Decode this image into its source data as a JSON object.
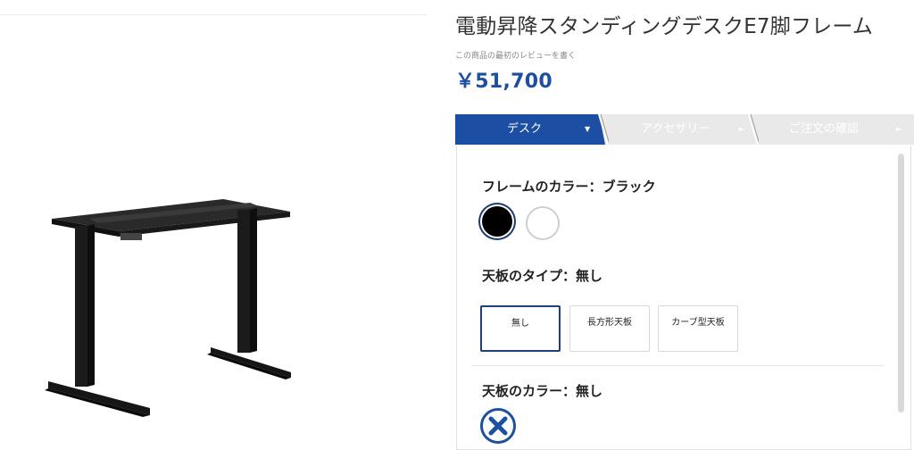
{
  "product": {
    "title": "電動昇降スタンディングデスクE7脚フレーム",
    "review_link": "この商品の最初のレビューを書く",
    "price": "￥51,700"
  },
  "steps": [
    {
      "label": "デスク",
      "arrow": "▼"
    },
    {
      "label": "アクセサリー",
      "arrow": "►"
    },
    {
      "label": "ご注文の確認",
      "arrow": "►"
    }
  ],
  "options": {
    "frame_color": {
      "label": "フレームのカラー：",
      "value": "ブラック",
      "swatches": [
        "#000000",
        "#ffffff"
      ]
    },
    "top_type": {
      "label": "天板のタイプ：",
      "value": "無し",
      "choices": [
        "無し",
        "長方形天板",
        "カーブ型天板"
      ]
    },
    "top_color": {
      "label": "天板のカラー：",
      "value": "無し"
    }
  },
  "colors": {
    "accent": "#1c4fa3",
    "step_bg": "#e9e9e9",
    "price": "#1e4ea0"
  }
}
